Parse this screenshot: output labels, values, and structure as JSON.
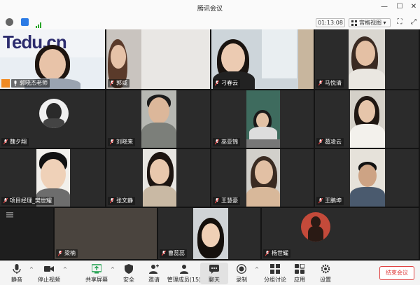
{
  "window": {
    "title": "腾讯会议"
  },
  "toolbar": {
    "timer": "01:13:08",
    "view_label": "宫格视图"
  },
  "participants": [
    {
      "name": "郭晓杰老师",
      "banner": "Tedu.cn"
    },
    {
      "name": "郭威"
    },
    {
      "name": "刁春云"
    },
    {
      "name": "马悦清"
    },
    {
      "name": "魏夕翔"
    },
    {
      "name": "刘晓来"
    },
    {
      "name": "巫亚锦"
    },
    {
      "name": "葛凌云"
    },
    {
      "name": "项目经理_樊世耀"
    },
    {
      "name": "张文静"
    },
    {
      "name": "王慧豪"
    },
    {
      "name": "王鹏坤"
    },
    {
      "name": ""
    },
    {
      "name": "梁楠"
    },
    {
      "name": "曹蕊蕊"
    },
    {
      "name": "杨世耀"
    }
  ],
  "bottom_bar": {
    "mute": "静音",
    "stop_video": "停止视频",
    "share_screen": "共享屏幕",
    "security": "安全",
    "invite": "邀请",
    "manage_members": "管理成员(15)",
    "chat": "聊天",
    "record": "录制",
    "breakout": "分组讨论",
    "apps": "应用",
    "settings": "设置",
    "end_meeting": "结束会议"
  },
  "colors": {
    "accent_red": "#e04040",
    "host_badge": "#f08a24",
    "tile_bg": "#2b2b2b"
  }
}
